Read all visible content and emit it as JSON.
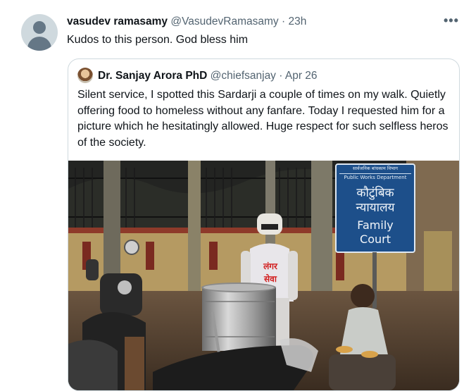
{
  "tweet": {
    "author_name": "vasudev ramasamy",
    "author_handle": "@VasudevRamasamy",
    "separator": "·",
    "time": "23h",
    "more": "•••",
    "text": "Kudos to this person. God bless him"
  },
  "quoted_tweet": {
    "author_name": "Dr. Sanjay Arora PhD",
    "author_handle": "@chiefsanjay",
    "separator": "·",
    "time": "Apr 26",
    "text": "Silent service, I spotted this Sardarji a couple of times on my walk. Quietly offering food to homeless without any fanfare. Today I requested him for a picture which he hesitatingly allowed. Huge respect for such selfless heros of the society."
  },
  "photo": {
    "sign_top_hindi": "सार्वजनिक बांधकाम विभाग",
    "sign_top_english": "Public Works Department",
    "sign_hindi_1": "कौटुंबिक",
    "sign_hindi_2": "न्यायालय",
    "sign_english_1": "Family",
    "sign_english_2": "Court",
    "apron_text_1": "लंगर",
    "apron_text_2": "सेवा"
  }
}
